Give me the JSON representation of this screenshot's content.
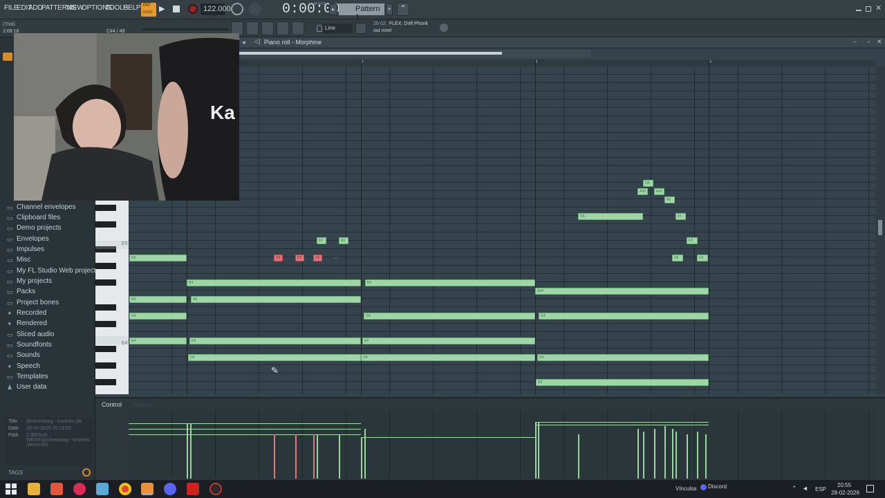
{
  "menubar": {
    "items": [
      "FILE",
      "EDIT",
      "ADD",
      "PATTERNS",
      "VIEW",
      "OPTIONS",
      "TOOLS",
      "HELP"
    ],
    "pat_label": "PAT",
    "song_label": "SONG",
    "tempo": "122.000",
    "time": "0:00:00",
    "time_unit": "M:S:CS",
    "pattern_name": "Pattern 1"
  },
  "info": {
    "trial": "(Trial)",
    "time_small": "2:08:18",
    "note_pos": "C#4 / 49"
  },
  "toolbar2": {
    "snap": "Line",
    "news_date": "26-02:",
    "news_title": "FLEX: Drift Phonk",
    "news_sub": "out now!"
  },
  "pianoroll": {
    "title": "Piano roll - Morphine",
    "ruler": [
      "3",
      "4",
      "5"
    ]
  },
  "browser": {
    "items": [
      "Channel envelopes",
      "Clipboard files",
      "Demo projects",
      "Envelopes",
      "Impulses",
      "Misc",
      "My FL Studio Web projects",
      "My projects",
      "Packs",
      "Project bones",
      "Recorded",
      "Rendered",
      "Sliced audio",
      "Soundfonts",
      "Sounds",
      "Speech",
      "Templates",
      "User data"
    ],
    "meta_labels": [
      "Title",
      "Date",
      "Path"
    ],
    "meta_values": [
      "@niinedawg - knvines (de",
      "28-02-2026 20:15:52",
      "Z:\\BENJA WEAS\\@niinedawg - knvines (demo kit)"
    ],
    "tags_label": "TAGS"
  },
  "keys": {
    "labels": [
      "E5",
      "E4"
    ]
  },
  "notes": {
    "labels": [
      "D5",
      "E5",
      "E5",
      "D5",
      "D5",
      "D5",
      "B4",
      "B4",
      "A4",
      "A4",
      "G4",
      "G4",
      "G4",
      "A#4",
      "E4",
      "E4",
      "E4",
      "D4",
      "D4",
      "D4",
      "B3",
      "G5",
      "A#5",
      "A#5",
      "A5",
      "G5",
      "F5",
      "E5",
      "D5",
      "D5"
    ]
  },
  "control": {
    "label": "Control",
    "sub": "Velocity"
  },
  "taskbar": {
    "links_label": "Vínculos",
    "discord_label": "Discord",
    "lang": "ESP",
    "time": "20:55",
    "date": "28-02-2026"
  },
  "colors": {
    "note_green": "#9fd6a5",
    "note_red": "#e0767b",
    "bg": "#34434c"
  }
}
